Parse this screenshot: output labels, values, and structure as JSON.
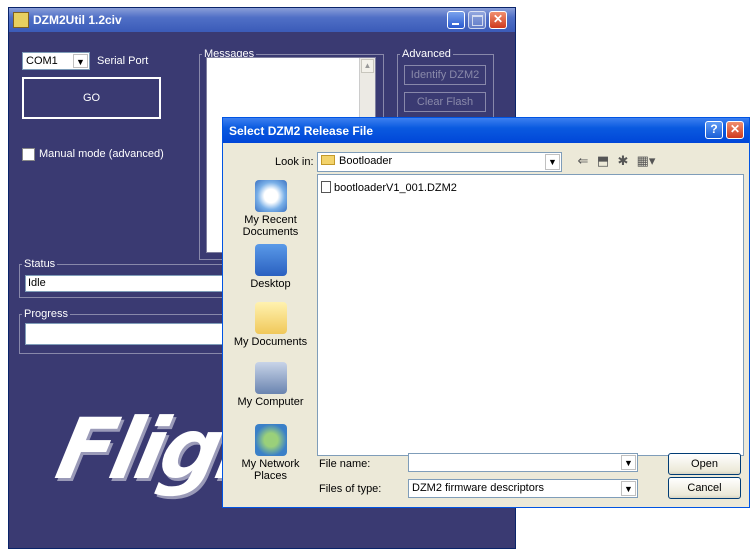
{
  "main": {
    "title": "DZM2Util 1.2civ",
    "port_value": "COM1",
    "port_label": "Serial Port",
    "go_label": "GO",
    "manual_mode_label": "Manual mode (advanced)",
    "messages_label": "Messages",
    "advanced_label": "Advanced",
    "identify_label": "Identify DZM2",
    "clear_flash_label": "Clear Flash",
    "status_label": "Status",
    "status_value": "Idle",
    "progress_label": "Progress",
    "progress": 0,
    "logo_text": "Fligh"
  },
  "dialog": {
    "title": "Select DZM2 Release File",
    "help_glyph": "?",
    "close_glyph": "✕",
    "look_in_label": "Look in:",
    "look_in_value": "Bootloader",
    "places": [
      {
        "label": "My Recent Documents",
        "icon": "recent-documents-icon"
      },
      {
        "label": "Desktop",
        "icon": "desktop-icon"
      },
      {
        "label": "My Documents",
        "icon": "my-documents-icon"
      },
      {
        "label": "My Computer",
        "icon": "my-computer-icon"
      },
      {
        "label": "My Network Places",
        "icon": "network-places-icon"
      }
    ],
    "files": [
      {
        "name": "bootloaderV1_001.DZM2"
      }
    ],
    "file_name_label": "File name:",
    "file_name_value": "",
    "file_type_label": "Files of type:",
    "file_type_value": "DZM2 firmware descriptors",
    "open_label": "Open",
    "cancel_label": "Cancel"
  },
  "colors": {
    "main_bg": "#3a3a72",
    "dialog_bg": "#ece9d8",
    "titlebar_blue": "#0a5ae0"
  }
}
